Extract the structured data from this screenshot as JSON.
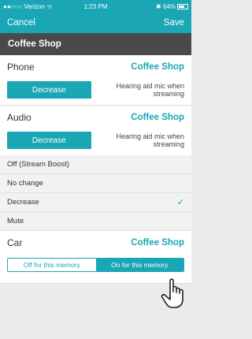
{
  "status_bar": {
    "carrier": "●●○○○ Verizon",
    "wifi_icon": "wifi-icon",
    "time": "1:23 PM",
    "bluetooth_icon": "bluetooth-icon",
    "battery_percent": "64%"
  },
  "nav": {
    "cancel_label": "Cancel",
    "save_label": "Save"
  },
  "section_title": "Coffee Shop",
  "phone": {
    "label": "Phone",
    "value": "Coffee Shop",
    "button_label": "Decrease",
    "note": "Hearing aid mic when streaming"
  },
  "audio": {
    "label": "Audio",
    "value": "Coffee Shop",
    "button_label": "Decrease",
    "note": "Hearing aid mic when streaming"
  },
  "options": [
    {
      "label": "Off (Stream Boost)",
      "selected": false
    },
    {
      "label": "No change",
      "selected": false
    },
    {
      "label": "Decrease",
      "selected": true,
      "check": "✓"
    },
    {
      "label": "Mute",
      "selected": false
    }
  ],
  "car": {
    "label": "Car",
    "value": "Coffee Shop",
    "toggle_off": "Off for this memory",
    "toggle_on": "On for this memory",
    "selected": "on"
  },
  "colors": {
    "accent": "#1aa6b5",
    "section_header": "#4a4a4a",
    "background": "#ebebeb"
  },
  "cursor_icon": "hand-pointer-icon"
}
